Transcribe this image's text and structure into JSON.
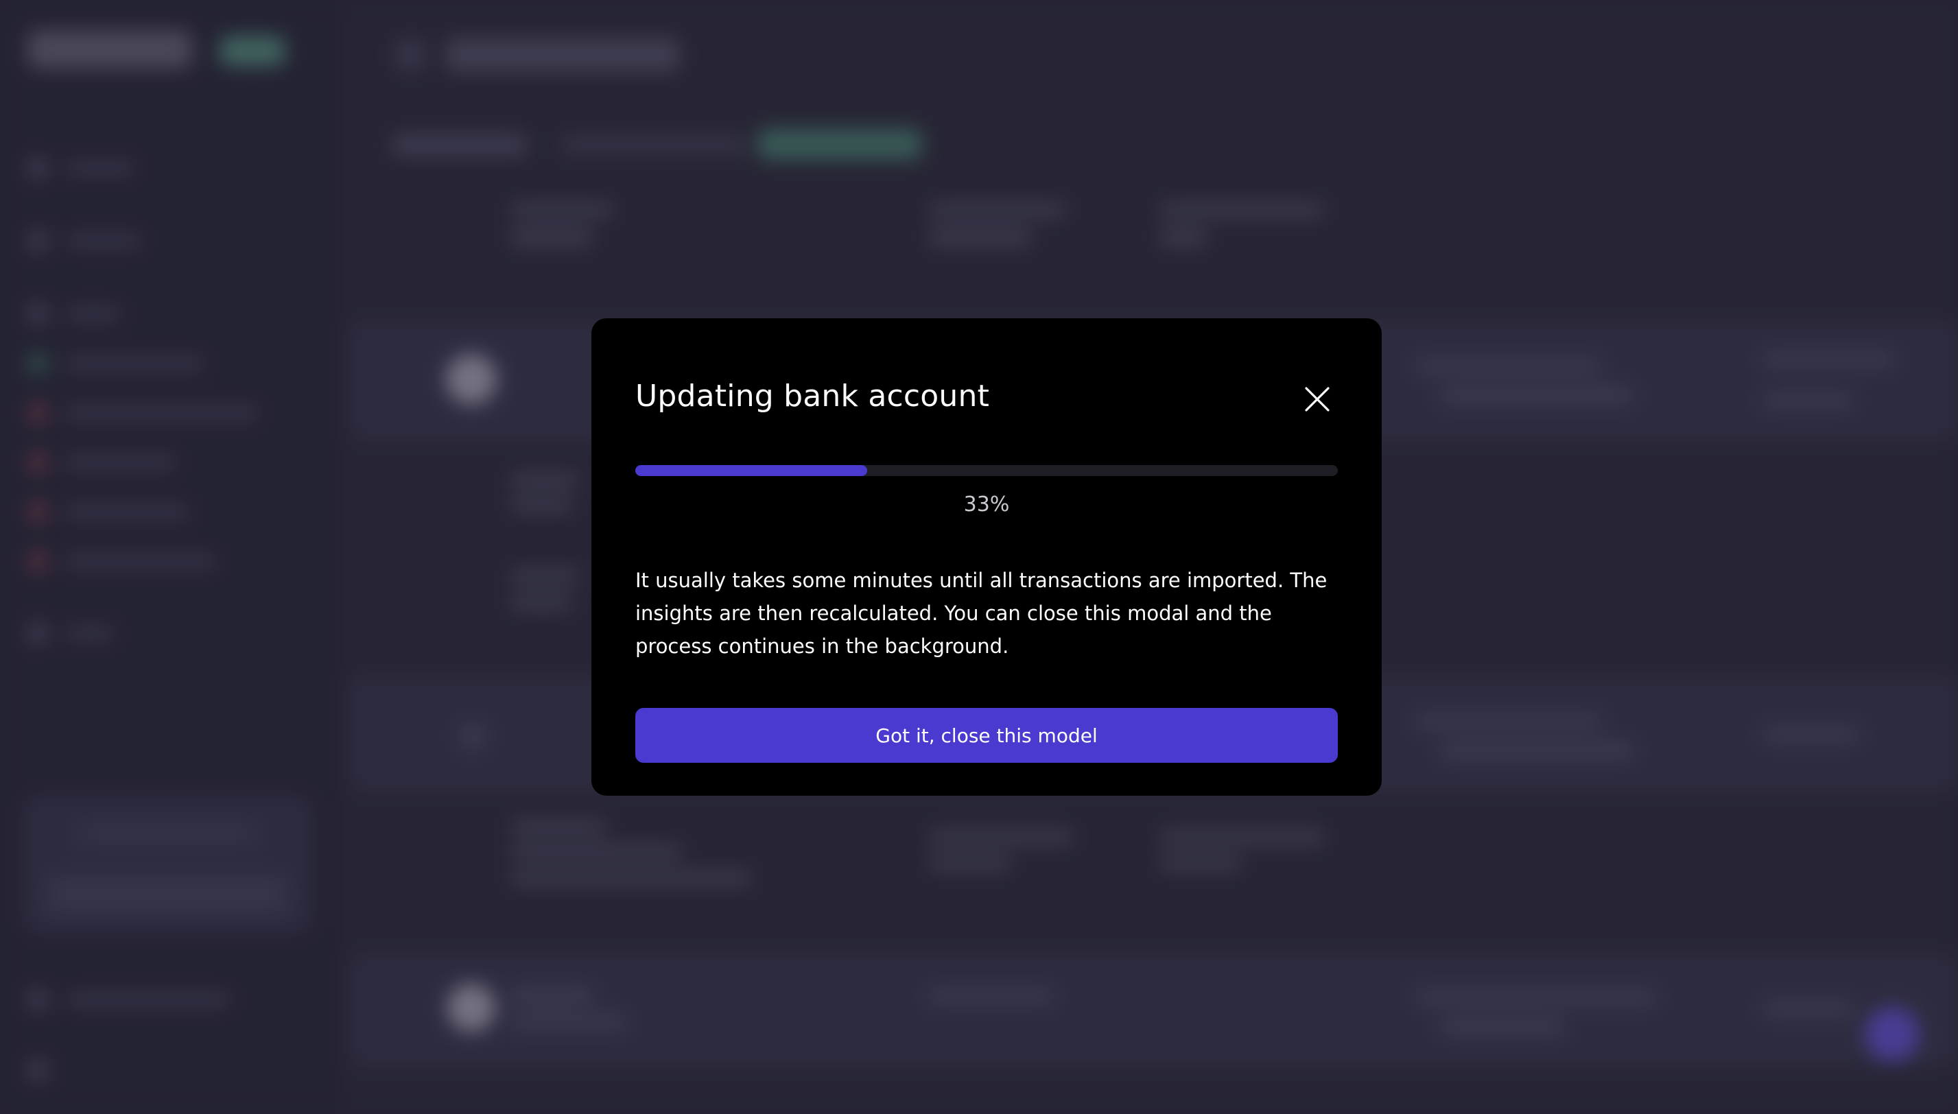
{
  "modal": {
    "title": "Updating bank account",
    "progress_percent": 33,
    "progress_label": "33%",
    "body": "It usually takes some minutes until all transactions are imported. The insights are then recalculated. You can close this modal and the process continues in the background.",
    "confirm_label": "Got it, close this model",
    "close_icon": "close-icon"
  },
  "colors": {
    "accent": "#4a3ad0",
    "modal_bg": "#000000",
    "backdrop": "#2e2d3d",
    "progress_track": "#1e1e24"
  }
}
